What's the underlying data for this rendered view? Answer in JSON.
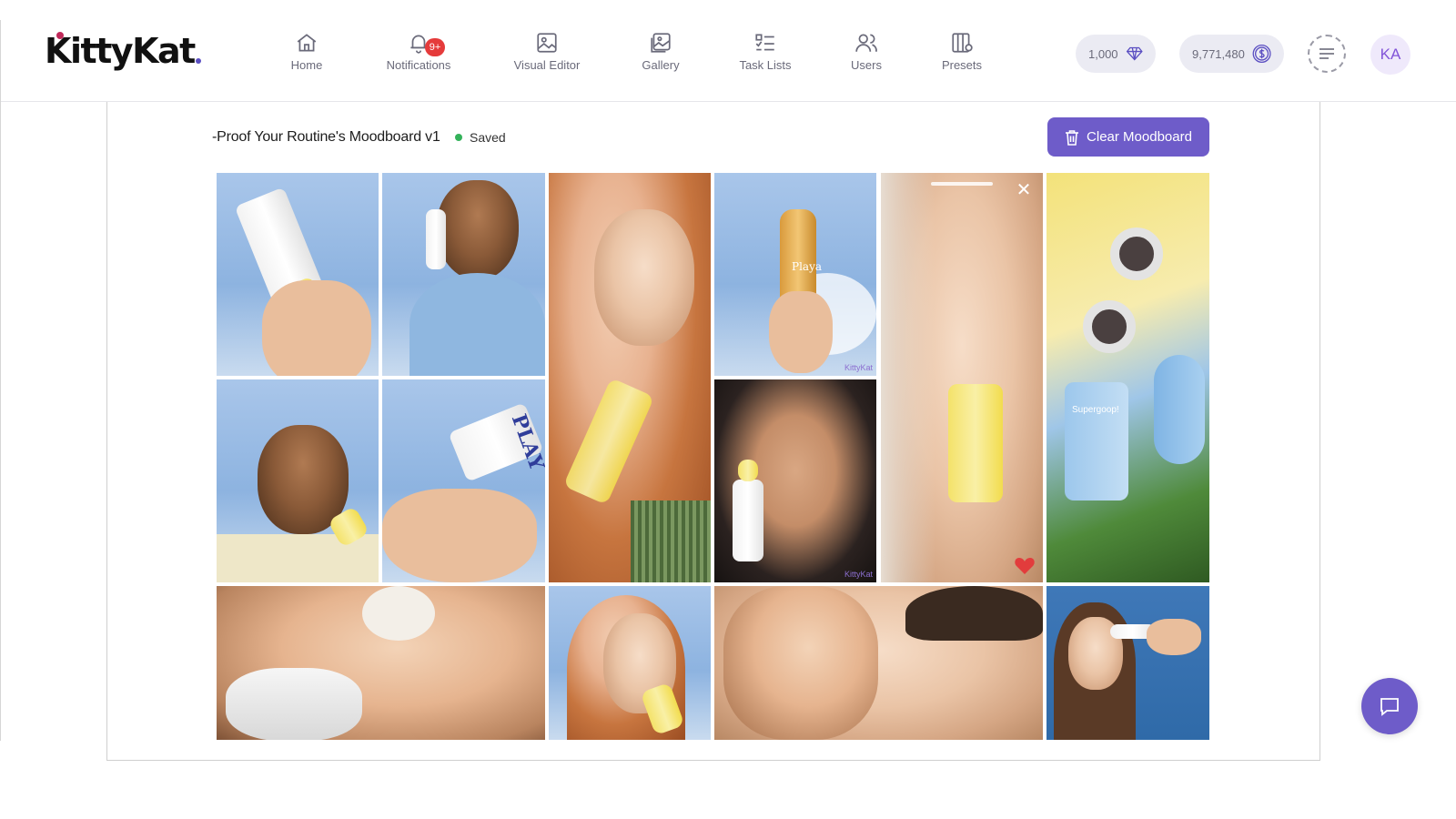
{
  "brand": {
    "name": "KittyKat"
  },
  "nav": {
    "items": [
      {
        "label": "Home",
        "icon": "home-icon"
      },
      {
        "label": "Notifications",
        "icon": "bell-icon",
        "badge": "9+"
      },
      {
        "label": "Visual Editor",
        "icon": "image-edit-icon"
      },
      {
        "label": "Gallery",
        "icon": "gallery-icon"
      },
      {
        "label": "Task Lists",
        "icon": "task-list-icon"
      },
      {
        "label": "Users",
        "icon": "users-icon"
      },
      {
        "label": "Presets",
        "icon": "presets-icon"
      }
    ]
  },
  "account": {
    "gems": "1,000",
    "credits": "9,771,480",
    "avatar_initials": "KA"
  },
  "board": {
    "title": "-Proof Your Routine's Moodboard v1",
    "status": "Saved",
    "clear_label": "Clear Moodboard",
    "tile_watermark": "KittyKat",
    "tile_labels": {
      "sunscreen_tube": "PLAY",
      "serum_bottle": "Playa",
      "stick_label": "Supergoop!"
    },
    "active_tile": {
      "liked": true
    }
  },
  "colors": {
    "accent": "#6e5cc9",
    "status_saved": "#34b25a",
    "badge": "#e53b3b",
    "heart": "#e23c3c"
  }
}
